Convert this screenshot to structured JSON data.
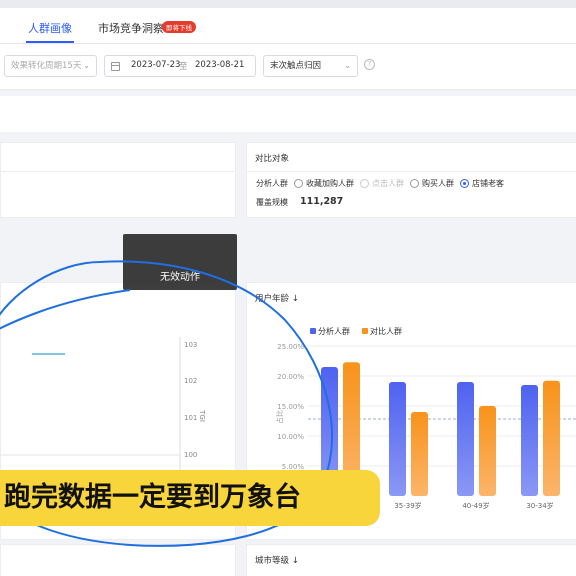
{
  "tabs": [
    {
      "label": "人群画像",
      "active": true
    },
    {
      "label": "市场竞争洞察",
      "active": false
    }
  ],
  "tab_badge": "即将下线",
  "filters": {
    "period_select": "效果转化周期15天",
    "date_start": "2023-07-23",
    "date_sep": "至",
    "date_end": "2023-08-21",
    "attribution_select": "末次触点归因"
  },
  "compare": {
    "title": "对比对象",
    "group_label": "分析人群",
    "options": [
      {
        "label": "收藏加购人群",
        "state": "off"
      },
      {
        "label": "点击人群",
        "state": "disabled"
      },
      {
        "label": "购买人群",
        "state": "off"
      },
      {
        "label": "店铺老客",
        "state": "on"
      }
    ],
    "coverage_label": "覆盖规模",
    "coverage_value": "111,287"
  },
  "toast": "无效动作",
  "left_chart": {
    "y_ticks": [
      "103",
      "102",
      "101",
      "100"
    ],
    "y_label": "TGI"
  },
  "age_chart": {
    "title": "用户年龄 ↓",
    "legend": [
      "分析人群",
      "对比人群"
    ],
    "colors": {
      "analysis": "#4f62f0",
      "compare": "#f7931a"
    },
    "y_label": "占比",
    "y_ticks": [
      "25.00%",
      "20.00%",
      "15.00%",
      "10.00%",
      "5.00%"
    ]
  },
  "city_card_title": "城市等级 ↓",
  "caption": "跑完数据一定要到万象台",
  "chart_data": {
    "type": "bar",
    "categories": [
      "",
      "35-39岁",
      "40-49岁",
      "30-34岁"
    ],
    "series": [
      {
        "name": "分析人群",
        "values": [
          21.5,
          19.0,
          19.0,
          18.5
        ]
      },
      {
        "name": "对比人群",
        "values": [
          22.3,
          14.0,
          15.0,
          19.2
        ]
      }
    ],
    "ylabel": "占比",
    "ylim": [
      0,
      25
    ]
  }
}
